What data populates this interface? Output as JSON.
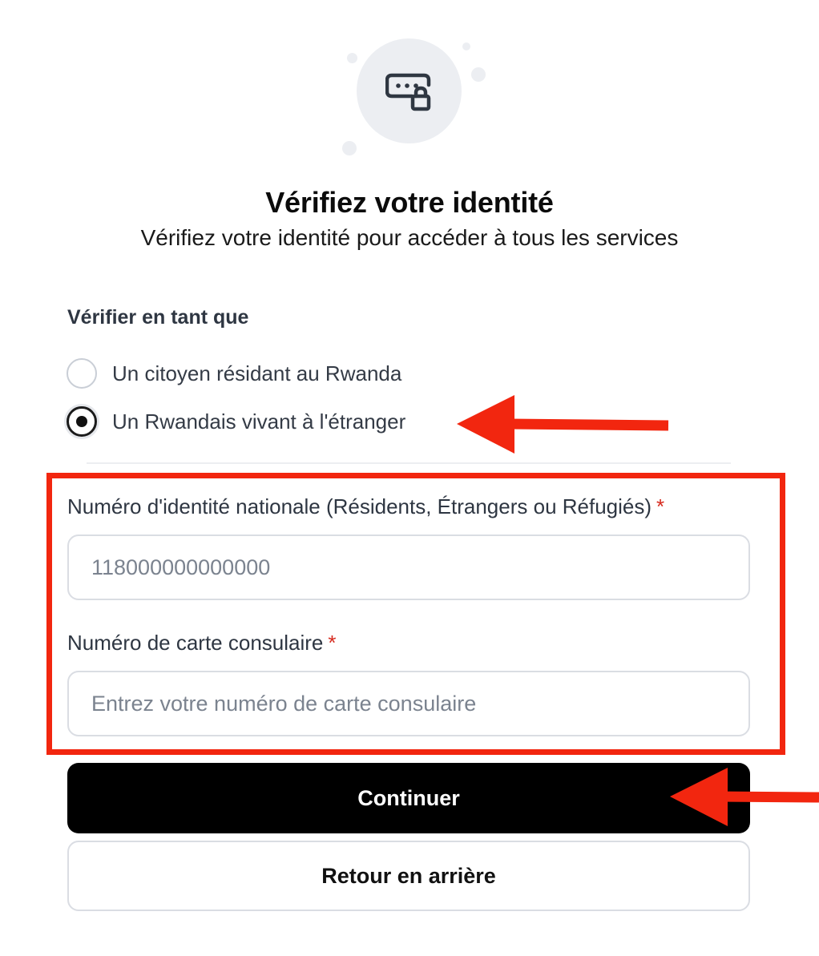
{
  "hero": {
    "icon": "password-lock-icon"
  },
  "header": {
    "title": "Vérifiez votre identité",
    "subtitle": "Vérifiez votre identité pour accéder à tous les services"
  },
  "verify_as": {
    "label": "Vérifier en tant que",
    "options": [
      {
        "label": "Un citoyen résidant au Rwanda",
        "selected": false
      },
      {
        "label": "Un Rwandais vivant à l'étranger",
        "selected": true
      }
    ]
  },
  "fields": {
    "national_id": {
      "label": "Numéro d'identité nationale (Résidents, Étrangers ou Réfugiés)",
      "required_mark": "*",
      "value": "",
      "placeholder": "118000000000000"
    },
    "consular_card": {
      "label": "Numéro de carte consulaire",
      "required_mark": "*",
      "value": "",
      "placeholder": "Entrez votre numéro de carte consulaire"
    }
  },
  "actions": {
    "continue_label": "Continuer",
    "back_label": "Retour en arrière"
  },
  "colors": {
    "primary_button": "#000000",
    "required": "#d62a1e",
    "annotation": "#f2260f"
  }
}
